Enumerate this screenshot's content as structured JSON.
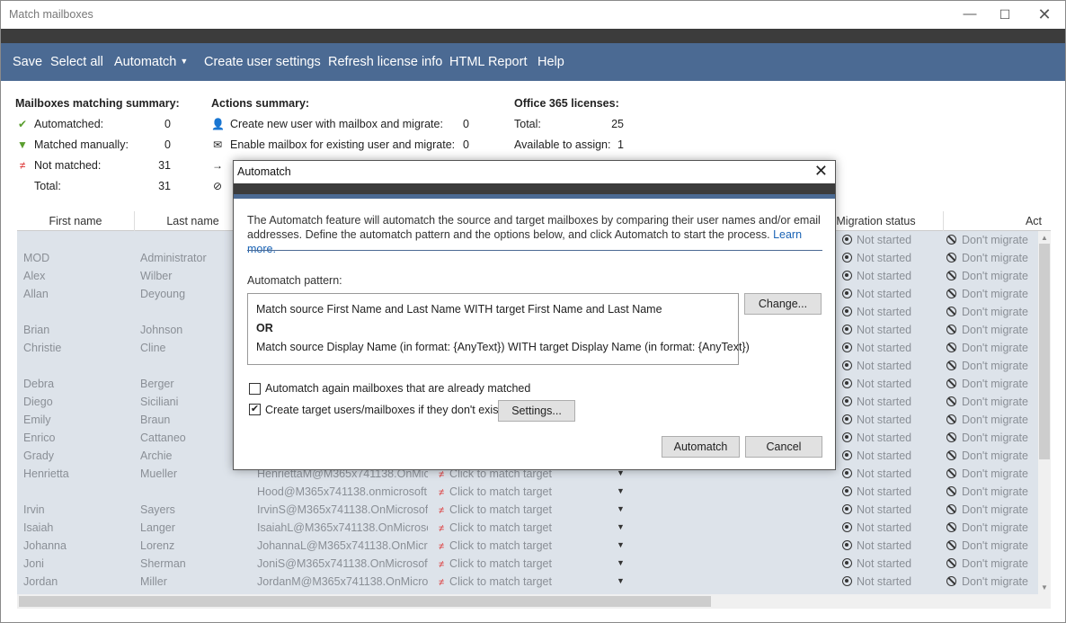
{
  "window": {
    "title": "Match mailboxes"
  },
  "menu": {
    "save": "Save",
    "select_all": "Select all",
    "automatch": "Automatch",
    "create_user_settings": "Create user settings",
    "refresh_license": "Refresh license info",
    "html_report": "HTML Report",
    "help": "Help"
  },
  "summary": {
    "matching": {
      "title": "Mailboxes matching summary:",
      "automatched_label": "Automatched:",
      "automatched_value": "0",
      "manual_label": "Matched manually:",
      "manual_value": "0",
      "not_matched_label": "Not matched:",
      "not_matched_value": "31",
      "total_label": "Total:",
      "total_value": "31"
    },
    "actions": {
      "title": "Actions summary:",
      "create_label": "Create new user with mailbox and migrate:",
      "create_value": "0",
      "enable_label": "Enable mailbox for existing user and migrate:",
      "enable_value": "0"
    },
    "licenses": {
      "title": "Office 365 licenses:",
      "total_label": "Total:",
      "total_value": "25",
      "available_label": "Available to assign:",
      "available_value": "1"
    }
  },
  "grid": {
    "headers": {
      "first": "First name",
      "last": "Last name",
      "migration": "Migration status",
      "action": "Act"
    },
    "rows": [
      {
        "first": "",
        "last": "",
        "email": "",
        "match": "",
        "status": "Not started",
        "action": "Don't migrate"
      },
      {
        "first": "MOD",
        "last": "Administrator",
        "email": "",
        "match": "",
        "status": "Not started",
        "action": "Don't migrate"
      },
      {
        "first": "Alex",
        "last": "Wilber",
        "email": "",
        "match": "",
        "status": "Not started",
        "action": "Don't migrate"
      },
      {
        "first": "Allan",
        "last": "Deyoung",
        "email": "",
        "match": "",
        "status": "Not started",
        "action": "Don't migrate"
      },
      {
        "first": "",
        "last": "",
        "email": "",
        "match": "",
        "status": "Not started",
        "action": "Don't migrate"
      },
      {
        "first": "Brian",
        "last": "Johnson",
        "email": "",
        "match": "",
        "status": "Not started",
        "action": "Don't migrate"
      },
      {
        "first": "Christie",
        "last": "Cline",
        "email": "",
        "match": "",
        "status": "Not started",
        "action": "Don't migrate"
      },
      {
        "first": "",
        "last": "",
        "email": "",
        "match": "",
        "status": "Not started",
        "action": "Don't migrate"
      },
      {
        "first": "Debra",
        "last": "Berger",
        "email": "",
        "match": "",
        "status": "Not started",
        "action": "Don't migrate"
      },
      {
        "first": "Diego",
        "last": "Siciliani",
        "email": "",
        "match": "",
        "status": "Not started",
        "action": "Don't migrate"
      },
      {
        "first": "Emily",
        "last": "Braun",
        "email": "",
        "match": "",
        "status": "Not started",
        "action": "Don't migrate"
      },
      {
        "first": "Enrico",
        "last": "Cattaneo",
        "email": "",
        "match": "",
        "status": "Not started",
        "action": "Don't migrate"
      },
      {
        "first": "Grady",
        "last": "Archie",
        "email": "",
        "match": "",
        "status": "Not started",
        "action": "Don't migrate"
      },
      {
        "first": "Henrietta",
        "last": "Mueller",
        "email": "HenriettaM@M365x741138.OnMicr",
        "match": "Click to match target",
        "status": "Not started",
        "action": "Don't migrate"
      },
      {
        "first": "",
        "last": "",
        "email": "Hood@M365x741138.onmicrosoft.c",
        "match": "Click to match target",
        "status": "Not started",
        "action": "Don't migrate"
      },
      {
        "first": "Irvin",
        "last": "Sayers",
        "email": "IrvinS@M365x741138.OnMicrosoft.c",
        "match": "Click to match target",
        "status": "Not started",
        "action": "Don't migrate"
      },
      {
        "first": "Isaiah",
        "last": "Langer",
        "email": "IsaiahL@M365x741138.OnMicrosoft",
        "match": "Click to match target",
        "status": "Not started",
        "action": "Don't migrate"
      },
      {
        "first": "Johanna",
        "last": "Lorenz",
        "email": "JohannaL@M365x741138.OnMicros",
        "match": "Click to match target",
        "status": "Not started",
        "action": "Don't migrate"
      },
      {
        "first": "Joni",
        "last": "Sherman",
        "email": "JoniS@M365x741138.OnMicrosoft.c",
        "match": "Click to match target",
        "status": "Not started",
        "action": "Don't migrate"
      },
      {
        "first": "Jordan",
        "last": "Miller",
        "email": "JordanM@M365x741138.OnMicros",
        "match": "Click to match target",
        "status": "Not started",
        "action": "Don't migrate"
      }
    ]
  },
  "dialog": {
    "title": "Automatch",
    "description": "The Automatch feature will automatch the source and target mailboxes by comparing their user names and/or email addresses. Define the automatch pattern and the options below, and click Automatch to start the process.",
    "learn_more": "Learn more.",
    "pattern_label": "Automatch pattern:",
    "pattern_line1": "Match source First Name and Last Name WITH target First Name and Last Name",
    "pattern_or": "OR",
    "pattern_line2": "Match source Display Name (in format: {AnyText}) WITH target Display Name (in format: {AnyText})",
    "change_button": "Change...",
    "option1_label": "Automatch again mailboxes that are already matched",
    "option1_checked": false,
    "option2_label": "Create target users/mailboxes if they don't exist",
    "option2_checked": true,
    "settings_button": "Settings...",
    "automatch_button": "Automatch",
    "cancel_button": "Cancel"
  }
}
